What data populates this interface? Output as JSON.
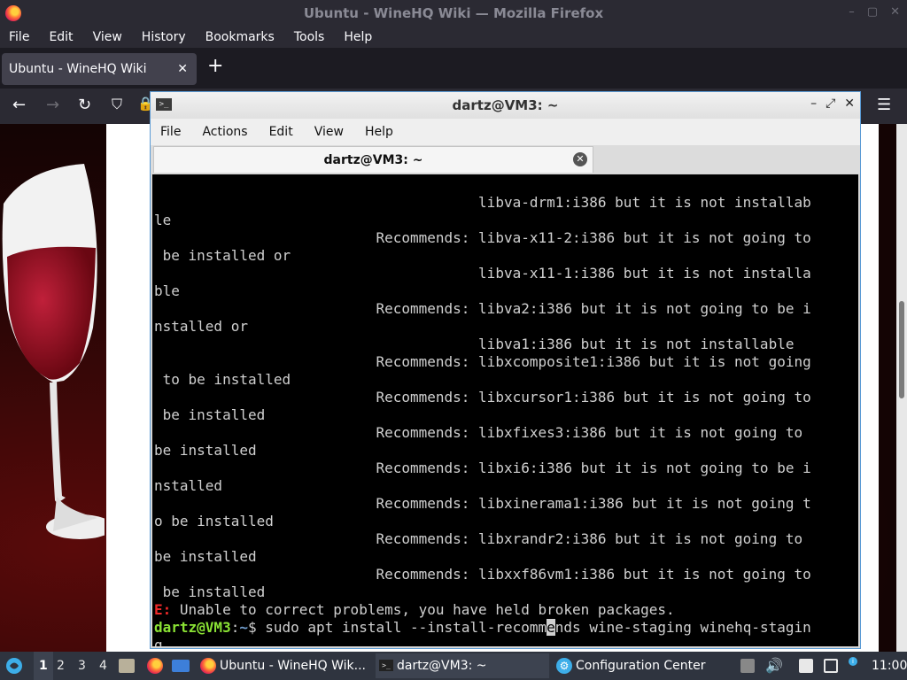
{
  "firefox": {
    "window_title": "Ubuntu - WineHQ Wiki — Mozilla Firefox",
    "menu": [
      "File",
      "Edit",
      "View",
      "History",
      "Bookmarks",
      "Tools",
      "Help"
    ],
    "tab_title": "Ubuntu - WineHQ Wiki"
  },
  "terminal": {
    "title": "dartz@VM3: ~",
    "menu": [
      "File",
      "Actions",
      "Edit",
      "View",
      "Help"
    ],
    "tab_label": "dartz@VM3: ~",
    "lines": [
      "                                      libva-drm1:i386 but it is not installab",
      "le",
      "                          Recommends: libva-x11-2:i386 but it is not going to",
      " be installed or",
      "                                      libva-x11-1:i386 but it is not installa",
      "ble",
      "                          Recommends: libva2:i386 but it is not going to be i",
      "nstalled or",
      "                                      libva1:i386 but it is not installable",
      "                          Recommends: libxcomposite1:i386 but it is not going",
      " to be installed",
      "                          Recommends: libxcursor1:i386 but it is not going to",
      " be installed",
      "                          Recommends: libxfixes3:i386 but it is not going to",
      "be installed",
      "                          Recommends: libxi6:i386 but it is not going to be i",
      "nstalled",
      "                          Recommends: libxinerama1:i386 but it is not going t",
      "o be installed",
      "                          Recommends: libxrandr2:i386 but it is not going to",
      "be installed",
      "                          Recommends: libxxf86vm1:i386 but it is not going to",
      " be installed"
    ],
    "error_prefix": "E:",
    "error_text": " Unable to correct problems, you have held broken packages.",
    "prompt_user": "dartz@VM3",
    "prompt_sep": ":",
    "prompt_path": "~",
    "prompt_dollar": "$",
    "command_before_cursor": " sudo apt install --install-recomm",
    "command_cursor_char": "e",
    "command_after_cursor": "nds wine-staging winehq-stagin",
    "command_wrap": "g"
  },
  "taskbar": {
    "workspaces": [
      "1",
      "2",
      "3",
      "4"
    ],
    "tasks": [
      "Ubuntu - WineHQ Wik...",
      "dartz@VM3: ~",
      "Configuration Center"
    ],
    "clock": "11:00"
  }
}
